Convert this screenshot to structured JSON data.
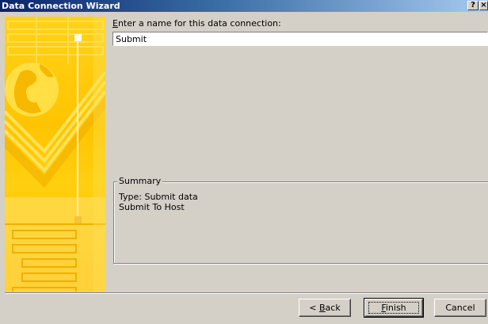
{
  "window": {
    "title": "Data Connection Wizard",
    "help_glyph": "?",
    "close_glyph": "×"
  },
  "form": {
    "prompt_label_first": "E",
    "prompt_label_rest": "nter a name for this data connection:",
    "connection_name": "Submit"
  },
  "summary": {
    "legend": "Summary",
    "lines": [
      "Type: Submit data",
      "Submit To Host"
    ]
  },
  "buttons": {
    "back_prefix": "< ",
    "back_mnemonic": "B",
    "back_rest": "ack",
    "finish_mnemonic": "F",
    "finish_rest": "inish",
    "cancel": "Cancel"
  },
  "colors": {
    "dialog_bg": "#d4d0c8",
    "titlebar_start": "#0a246a",
    "titlebar_end": "#a6caf0",
    "art_yellow": "#ffc400"
  },
  "icons": {
    "art": "wizard-globe-illustration"
  }
}
